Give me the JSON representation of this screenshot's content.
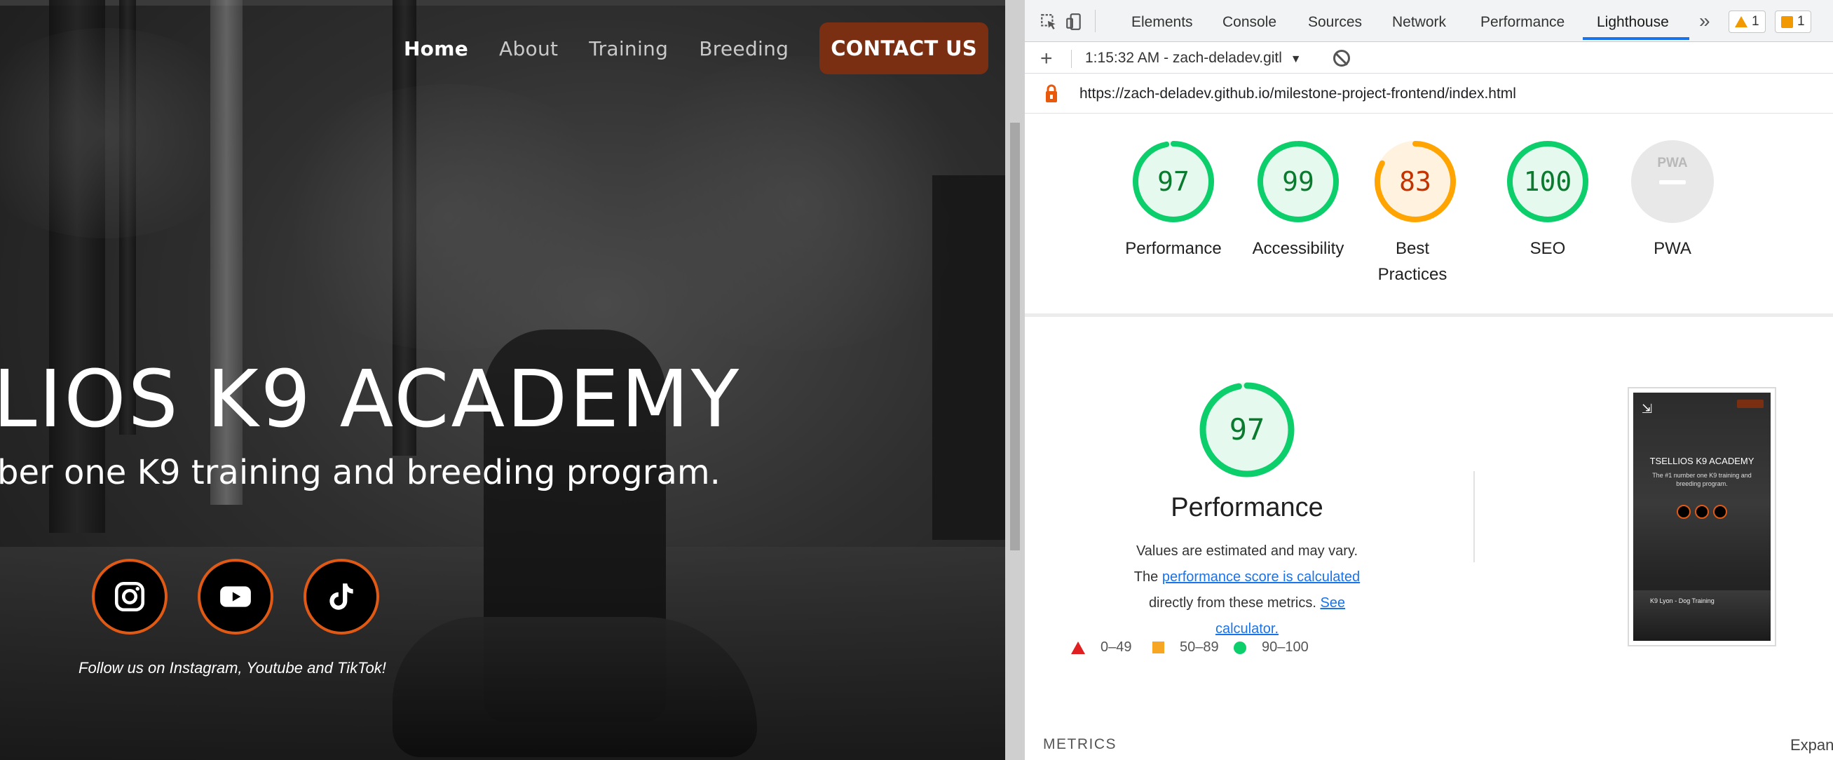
{
  "website": {
    "nav": {
      "items": [
        {
          "label": "Home",
          "active": true
        },
        {
          "label": "About",
          "active": false
        },
        {
          "label": "Training",
          "active": false
        },
        {
          "label": "Breeding",
          "active": false
        }
      ],
      "contact_label": "CONTACT US"
    },
    "hero": {
      "title": "LIOS K9 ACADEMY",
      "subtitle": "ber one K9 training and breeding program."
    },
    "socials": [
      "instagram-icon",
      "youtube-icon",
      "tiktok-icon"
    ],
    "follow_text": "Follow us on Instagram, Youtube and TikTok!",
    "accent_color": "#e05a15",
    "contact_color": "#7a2e12"
  },
  "devtools": {
    "tabs": [
      {
        "label": "Elements"
      },
      {
        "label": "Console"
      },
      {
        "label": "Sources"
      },
      {
        "label": "Network"
      },
      {
        "label": "Performance"
      },
      {
        "label": "Lighthouse"
      }
    ],
    "active_tab": "Lighthouse",
    "more_tabs_glyph": "»",
    "warnings_count": "1",
    "issues_count": "1",
    "report_selector": "1:15:32 AM - zach-deladev.gitl",
    "url": "https://zach-deladev.github.io/milestone-project-frontend/index.html",
    "scores": [
      {
        "label": "Performance",
        "value": "97",
        "score": 0.97,
        "color": "#0cce6b",
        "text_color": "#0a7a2e",
        "bg": "#e6f9ef"
      },
      {
        "label": "Accessibility",
        "value": "99",
        "score": 0.99,
        "color": "#0cce6b",
        "text_color": "#0a7a2e",
        "bg": "#e6f9ef"
      },
      {
        "label": "Best Practices",
        "value": "83",
        "score": 0.83,
        "color": "#ffa400",
        "text_color": "#c33300",
        "bg": "#fff3e0"
      },
      {
        "label": "SEO",
        "value": "100",
        "score": 1.0,
        "color": "#0cce6b",
        "text_color": "#0a7a2e",
        "bg": "#e6f9ef"
      }
    ],
    "pwa": {
      "label": "PWA",
      "badge": "PWA"
    },
    "performance_section": {
      "score": "97",
      "score_fraction": 0.97,
      "title": "Performance",
      "desc_prefix": "Values are estimated and may vary. The ",
      "desc_link1": "performance score is calculated",
      "desc_mid": " directly from these metrics. ",
      "desc_link2": "See calculator.",
      "legend": [
        {
          "shape": "triangle",
          "range": "0–49",
          "color": "#e02020"
        },
        {
          "shape": "square",
          "range": "50–89",
          "color": "#f6a623"
        },
        {
          "shape": "circle",
          "range": "90–100",
          "color": "#0cce6b"
        }
      ]
    },
    "thumbnail": {
      "title": "TSELLIOS K9 ACADEMY",
      "subtitle": "The #1 number one K9 training and breeding program.",
      "video_caption": "K9 Lyon - Dog Training"
    },
    "metrics_label": "METRICS",
    "expand_label": "Expan"
  }
}
